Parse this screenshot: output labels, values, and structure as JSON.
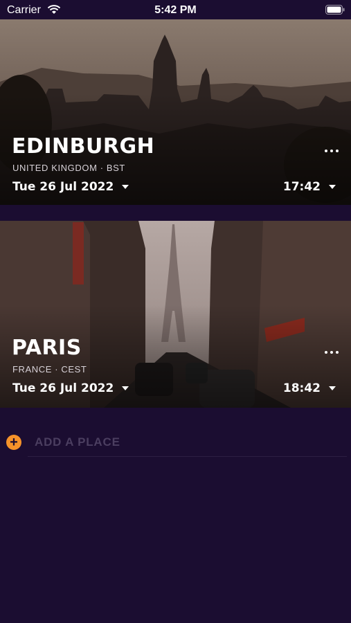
{
  "status_bar": {
    "carrier": "Carrier",
    "time": "5:42 PM"
  },
  "cities": [
    {
      "name": "EDINBURGH",
      "subtitle": "UNITED KINGDOM · BST",
      "date": "Tue 26 Jul 2022",
      "time": "17:42"
    },
    {
      "name": "PARIS",
      "subtitle": "FRANCE · CEST",
      "date": "Tue 26 Jul 2022",
      "time": "18:42"
    }
  ],
  "add_place": {
    "label": "ADD A PLACE",
    "icon": "plus-icon"
  },
  "colors": {
    "background": "#1b0d31",
    "accent": "#f5922a",
    "muted": "#4b3e60"
  }
}
